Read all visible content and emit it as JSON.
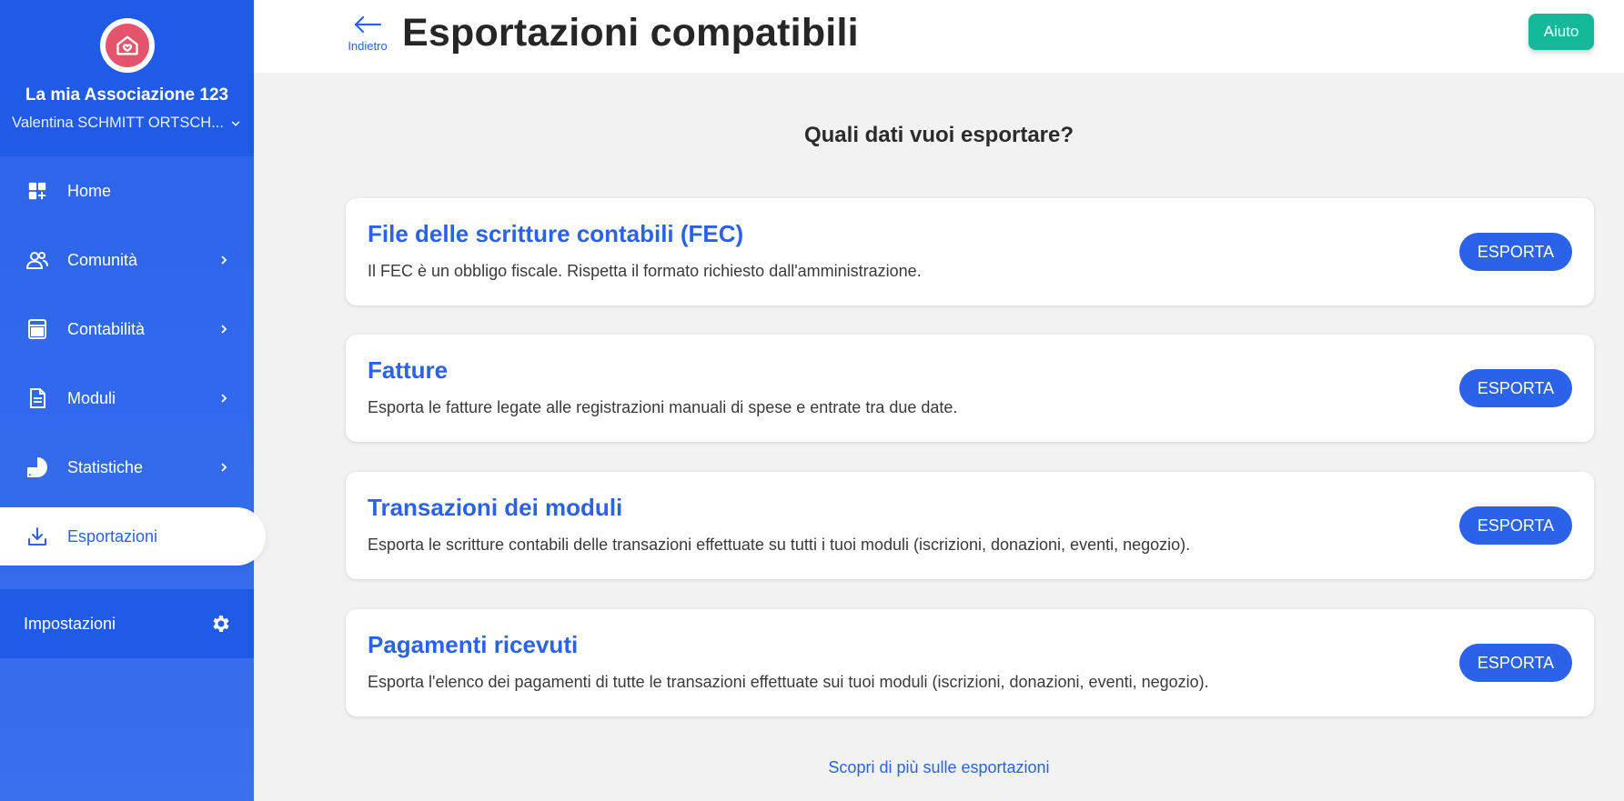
{
  "sidebar": {
    "org_name": "La mia Associazione 123",
    "user_name": "Valentina SCHMITT ORTSCH...",
    "items": [
      {
        "label": "Home",
        "icon": "home-grid-icon"
      },
      {
        "label": "Comunità",
        "icon": "community-icon"
      },
      {
        "label": "Contabilità",
        "icon": "calculator-icon"
      },
      {
        "label": "Moduli",
        "icon": "document-icon"
      },
      {
        "label": "Statistiche",
        "icon": "pie-chart-icon"
      },
      {
        "label": "Esportazioni",
        "icon": "download-icon",
        "active": true
      }
    ],
    "settings_label": "Impostazioni"
  },
  "header": {
    "back_label": "Indietro",
    "title": "Esportazioni compatibili",
    "help_label": "Aiuto"
  },
  "main": {
    "question": "Quali dati vuoi esportare?",
    "cards": [
      {
        "title": "File delle scritture contabili (FEC)",
        "description": "Il FEC è un obbligo fiscale. Rispetta il formato richiesto dall'amministrazione.",
        "button": "ESPORTA"
      },
      {
        "title": "Fatture",
        "description": "Esporta le fatture legate alle registrazioni manuali di spese e entrate tra due date.",
        "button": "ESPORTA"
      },
      {
        "title": "Transazioni dei moduli",
        "description": "Esporta le scritture contabili delle transazioni effettuate su tutti i tuoi moduli (iscrizioni, donazioni, eventi, negozio).",
        "button": "ESPORTA"
      },
      {
        "title": "Pagamenti ricevuti",
        "description": "Esporta l'elenco dei pagamenti di tutte le transazioni effettuate sui tuoi moduli (iscrizioni, donazioni, eventi, negozio).",
        "button": "ESPORTA"
      }
    ],
    "learn_more": "Scopri di più sulle esportazioni"
  },
  "colors": {
    "primary": "#2a63ea",
    "sidebar_dark": "#1f5be6",
    "help": "#14b89a",
    "logo": "#e4546a",
    "background": "#f2f2f2"
  }
}
